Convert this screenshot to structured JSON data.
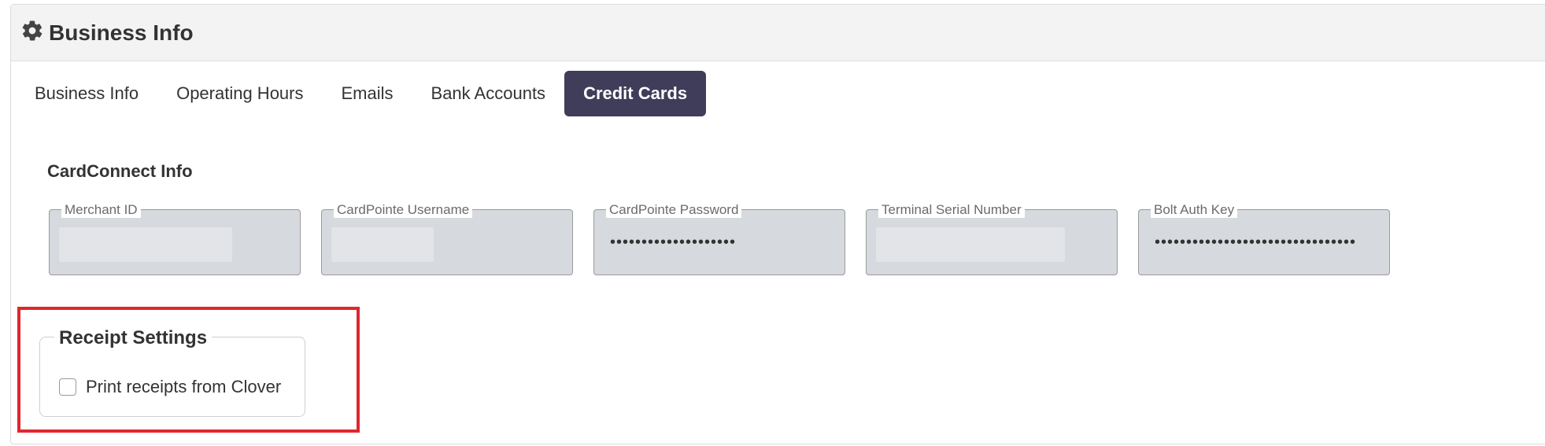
{
  "header": {
    "title": "Business Info",
    "icon": "gear-icon"
  },
  "tabs": [
    {
      "label": "Business Info",
      "active": false
    },
    {
      "label": "Operating Hours",
      "active": false
    },
    {
      "label": "Emails",
      "active": false
    },
    {
      "label": "Bank Accounts",
      "active": false
    },
    {
      "label": "Credit Cards",
      "active": true
    }
  ],
  "cardconnect": {
    "title": "CardConnect Info",
    "fields": [
      {
        "label": "Merchant ID",
        "value": ""
      },
      {
        "label": "CardPointe Username",
        "value": ""
      },
      {
        "label": "CardPointe Password",
        "value": "••••••••••••••••••••"
      },
      {
        "label": "Terminal Serial Number",
        "value": ""
      },
      {
        "label": "Bolt Auth Key",
        "value": "••••••••••••••••••••••••••••••••"
      }
    ]
  },
  "receipt_settings": {
    "title": "Receipt Settings",
    "print_from_clover": {
      "label": "Print receipts from Clover",
      "checked": false
    }
  },
  "colors": {
    "active_tab": "#3f3d5a",
    "highlight": "#e0262f",
    "field_bg": "#d6d9de"
  }
}
